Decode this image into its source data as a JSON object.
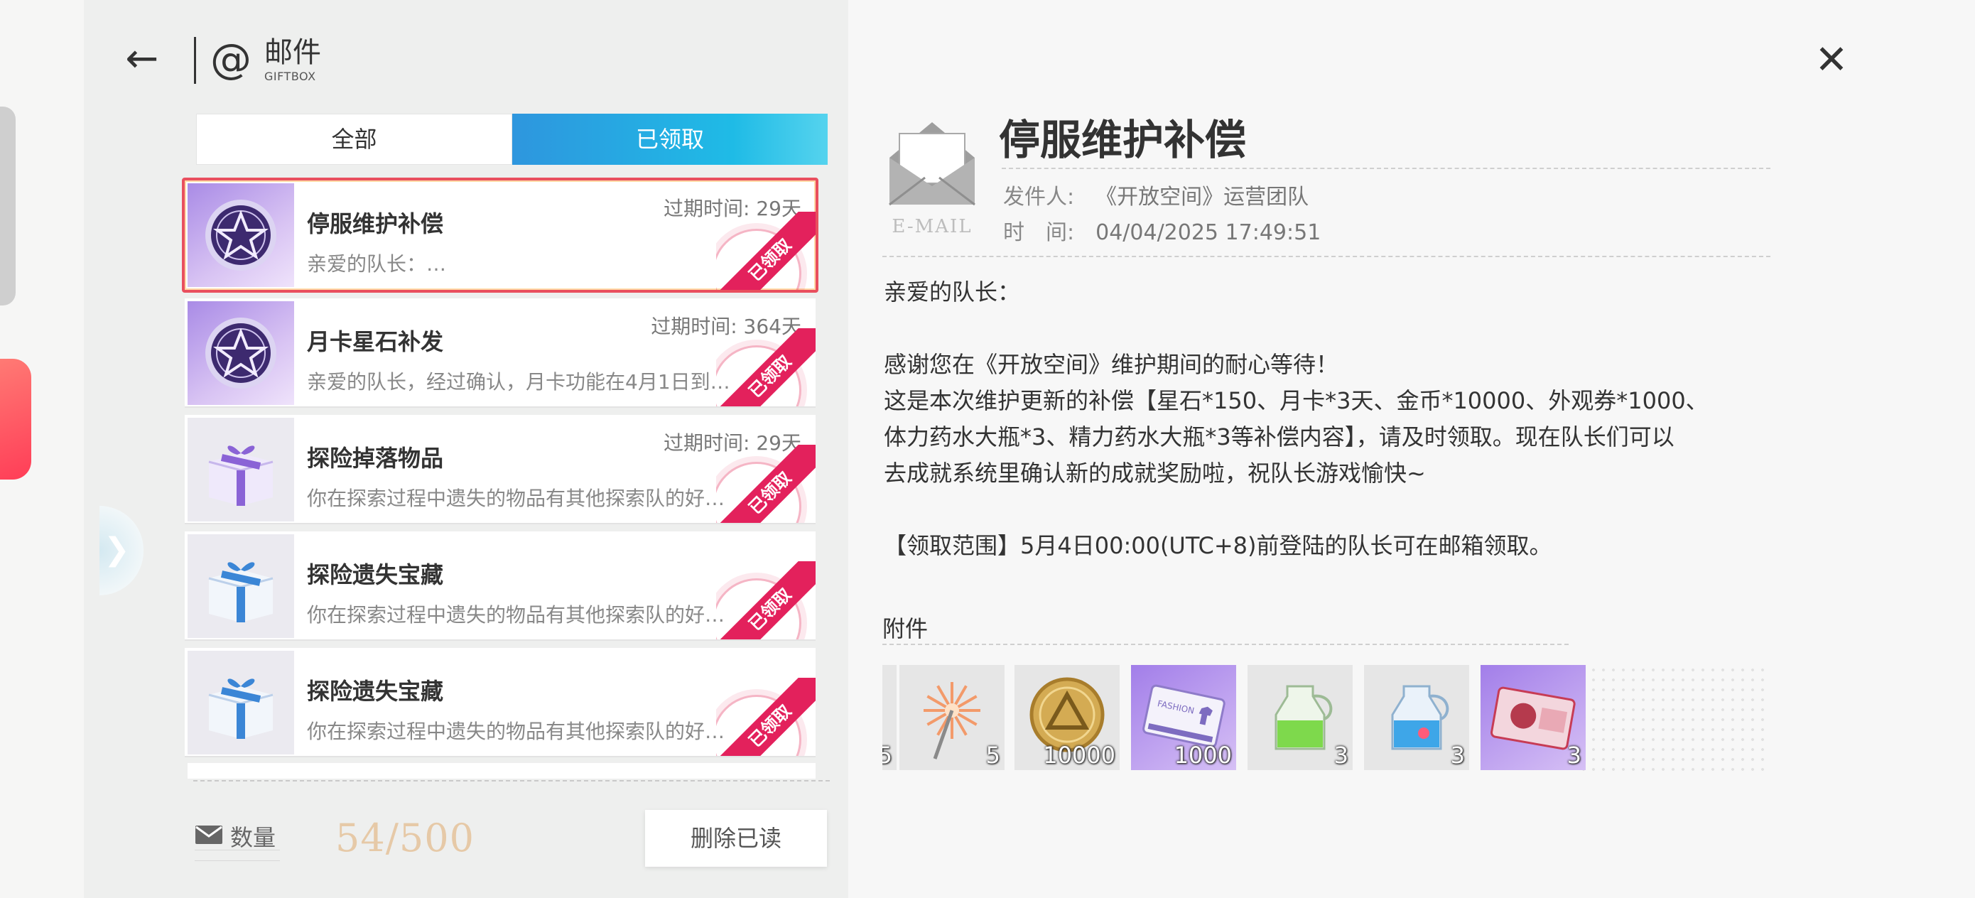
{
  "header": {
    "title": "邮件",
    "subtitle": "GIFTBOX"
  },
  "tabs": {
    "all": "全部",
    "claimed": "已领取"
  },
  "mails": [
    {
      "title": "停服维护补偿",
      "preview": "亲爱的队长：…",
      "expire": "过期时间: 29天",
      "stamp": "已领取",
      "icon": "star-coin-icon",
      "selected": true
    },
    {
      "title": "月卡星石补发",
      "preview": "亲爱的队长，经过确认，月卡功能在4月1日到…",
      "expire": "过期时间: 364天",
      "stamp": "已领取",
      "icon": "star-coin-icon"
    },
    {
      "title": "探险掉落物品",
      "preview": "你在探索过程中遗失的物品有其他探索队的好…",
      "expire": "过期时间: 29天",
      "stamp": "已领取",
      "icon": "purple-gift-icon"
    },
    {
      "title": "探险遗失宝藏",
      "preview": "你在探索过程中遗失的物品有其他探索队的好…",
      "expire": "",
      "stamp": "已领取",
      "icon": "blue-gift-icon"
    },
    {
      "title": "探险遗失宝藏",
      "preview": "你在探索过程中遗失的物品有其他探索队的好…",
      "expire": "",
      "stamp": "已领取",
      "icon": "blue-gift-icon"
    }
  ],
  "footer": {
    "qty_label": "数量",
    "qty_value": "54/500",
    "delete_label": "删除已读"
  },
  "detail": {
    "icon_label": "E-MAIL",
    "title": "停服维护补偿",
    "sender_label": "发件人:",
    "sender": "《开放空间》运营团队",
    "time_label": "时　间:",
    "time": "04/04/2025 17:49:51",
    "greeting": "亲爱的队长：",
    "body_lines": [
      "感谢您在《开放空间》维护期间的耐心等待！",
      "这是本次维护更新的补偿【星石*150、月卡*3天、金币*10000、外观券*1000、",
      "体力药水大瓶*3、精力药水大瓶*3等补偿内容】，请及时领取。现在队长们可以",
      "去成就系统里确认新的成就奖励啦，祝队长游戏愉快~"
    ],
    "range": "【领取范围】5月4日00:00(UTC+8)前登陆的队长可在邮箱领取。",
    "attach_label": "附件",
    "attachments": [
      {
        "name": "partial-item",
        "count": "5"
      },
      {
        "name": "firework-icon",
        "count": "5"
      },
      {
        "name": "gold-coin-icon",
        "count": "10000"
      },
      {
        "name": "fashion-voucher-icon",
        "count": "1000"
      },
      {
        "name": "green-potion-icon",
        "count": "3"
      },
      {
        "name": "blue-potion-icon",
        "count": "3"
      },
      {
        "name": "month-card-icon",
        "count": "3"
      }
    ]
  }
}
